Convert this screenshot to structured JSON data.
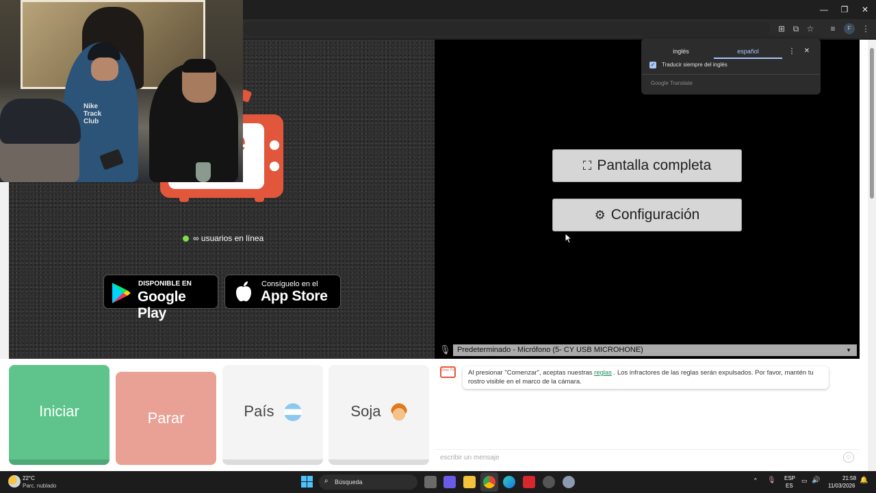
{
  "browser": {
    "translate_popup": {
      "tab_source": "inglés",
      "tab_target": "español",
      "checkbox_label": "Traducir siempre del inglés",
      "footer": "Google Translate"
    }
  },
  "page": {
    "online_text": "∞ usuarios en línea",
    "google_play": {
      "small": "DISPONIBLE EN",
      "big": "Google Play"
    },
    "app_store": {
      "small": "Consíguelo en el",
      "big": "App Store"
    },
    "fullscreen_label": "Pantalla completa",
    "settings_label": "Configuración",
    "microphone_select": "Predeterminado - Micrófono (5- CY USB MICROHONE)",
    "buttons": {
      "start": "Iniciar",
      "stop": "Parar",
      "country": "País",
      "gender": "Soja"
    },
    "chat": {
      "logo_text": "Ome TV",
      "message_before": "Al presionar \"Comenzar\", aceptas nuestras",
      "message_link": "reglas",
      "message_after": ". Los infractores de las reglas serán expulsados. Por favor, mantén tu rostro visible en el marco de la cámara.",
      "input_placeholder": "escribir un mensaje"
    }
  },
  "taskbar": {
    "weather_temp": "22°C",
    "weather_desc": "Parc. nublado",
    "search_placeholder": "Búsqueda",
    "lang_top": "ESP",
    "lang_bottom": "ES",
    "time": "21:58",
    "date": "11/03/2026"
  },
  "colors": {
    "start_button": "#5ec48b",
    "stop_button": "#e9a196",
    "brand_orange": "#e2563b"
  }
}
